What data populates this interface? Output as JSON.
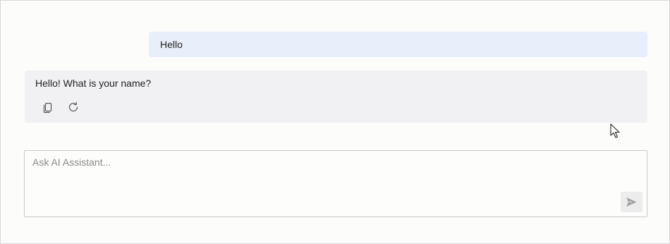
{
  "chat": {
    "messages": [
      {
        "role": "user",
        "text": "Hello"
      },
      {
        "role": "assistant",
        "text": "Hello! What is your name?"
      }
    ],
    "actions": [
      {
        "icon": "copy-icon"
      },
      {
        "icon": "refresh-icon"
      }
    ]
  },
  "composer": {
    "placeholder": "Ask AI Assistant...",
    "value": "",
    "send_icon": "send-icon"
  },
  "colors": {
    "user_bubble": "#e8eefa",
    "assistant_bubble": "#f1f1f3",
    "background": "#fcfcfb",
    "input_border": "#c9c9c9",
    "send_button": "#ececec"
  }
}
